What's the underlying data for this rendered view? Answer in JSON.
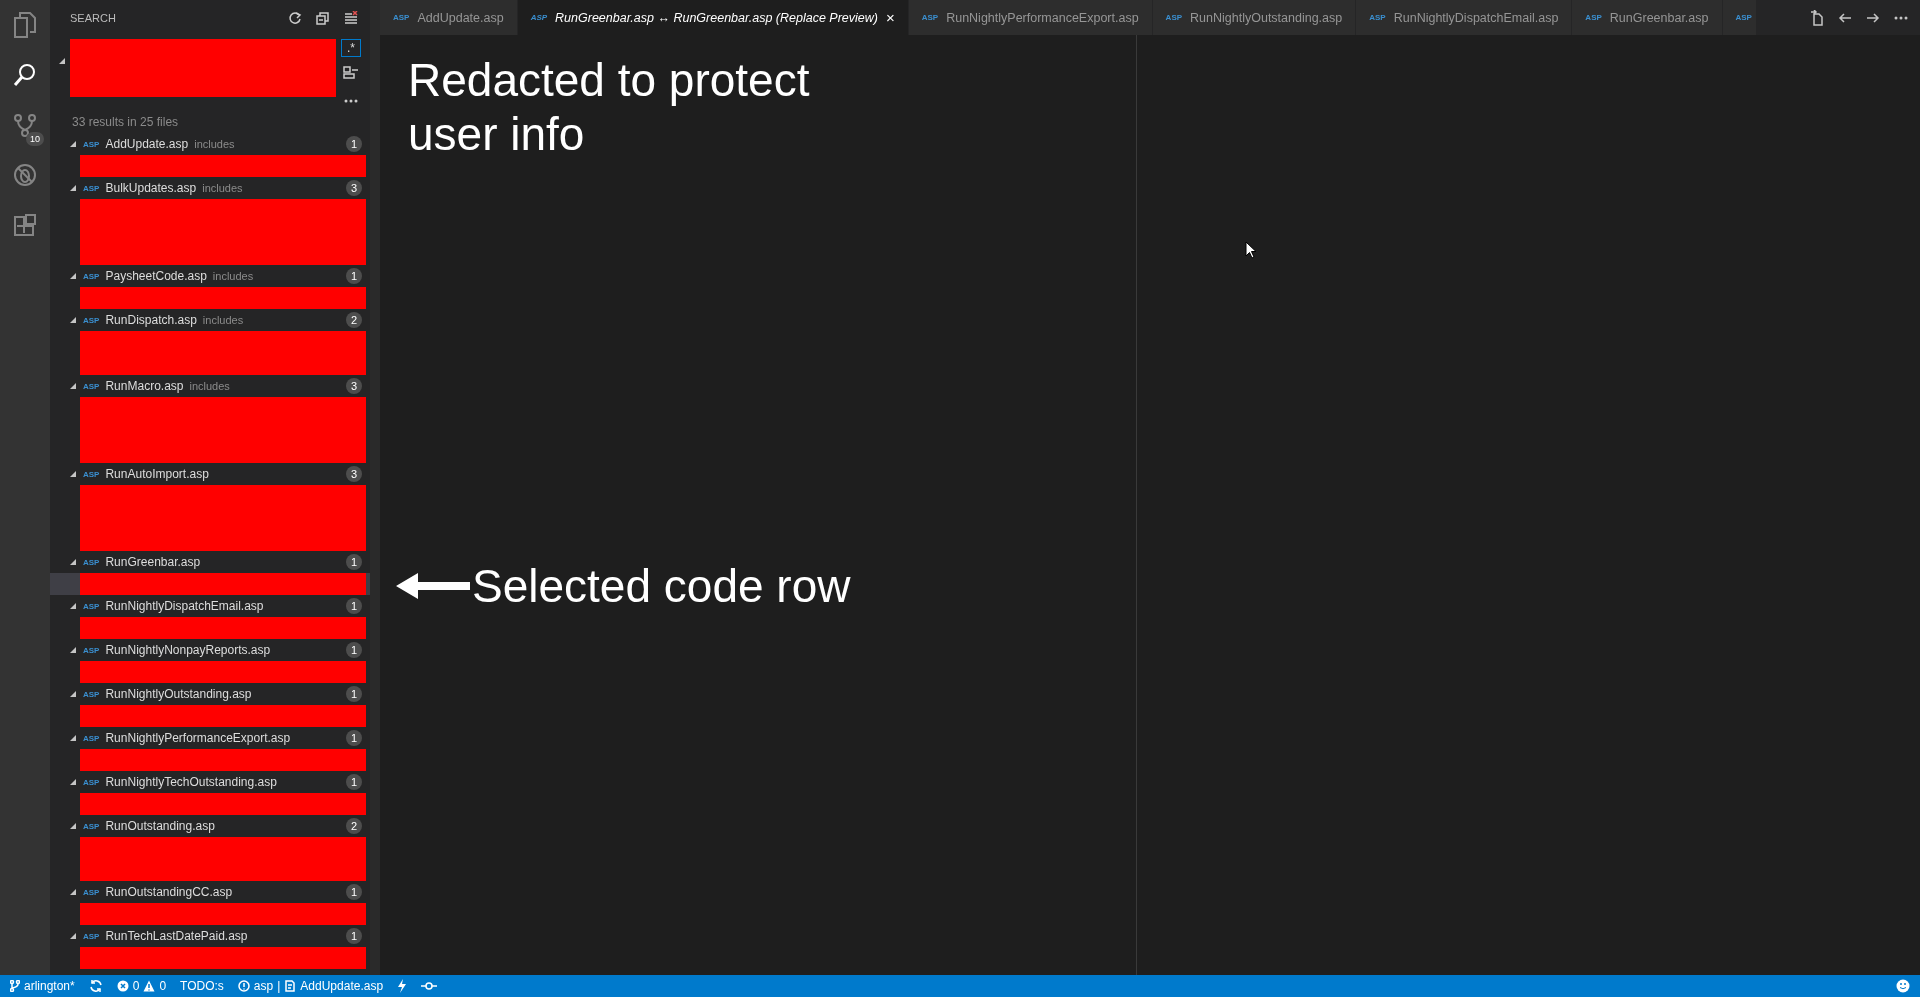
{
  "activity_bar": {
    "items": [
      {
        "kind": "files",
        "selected": false
      },
      {
        "kind": "search",
        "selected": true
      },
      {
        "kind": "source_control",
        "selected": false,
        "badge": "10"
      },
      {
        "kind": "debug",
        "selected": false
      },
      {
        "kind": "extensions",
        "selected": false
      }
    ]
  },
  "sidebar": {
    "title": "SEARCH",
    "search": {
      "kind": "redacted",
      "expanded": true,
      "regex": {
        "label": ".*",
        "on": true
      }
    },
    "summary": "33 results in 25 files",
    "files": [
      {
        "icon_label": "ASP",
        "name": "AddUpdate.asp",
        "detail": "includes",
        "count": "1",
        "expanded": true,
        "results": [
          {
            "kind": "redacted",
            "selected": false
          }
        ]
      },
      {
        "icon_label": "ASP",
        "name": "BulkUpdates.asp",
        "detail": "includes",
        "count": "3",
        "expanded": true,
        "results": [
          {
            "kind": "redacted",
            "selected": false
          },
          {
            "kind": "redacted",
            "selected": false
          },
          {
            "kind": "redacted",
            "selected": false
          }
        ]
      },
      {
        "icon_label": "ASP",
        "name": "PaysheetCode.asp",
        "detail": "includes",
        "count": "1",
        "expanded": true,
        "results": [
          {
            "kind": "redacted",
            "selected": false
          }
        ]
      },
      {
        "icon_label": "ASP",
        "name": "RunDispatch.asp",
        "detail": "includes",
        "count": "2",
        "expanded": true,
        "results": [
          {
            "kind": "redacted",
            "selected": false
          },
          {
            "kind": "redacted",
            "selected": false
          }
        ]
      },
      {
        "icon_label": "ASP",
        "name": "RunMacro.asp",
        "detail": "includes",
        "count": "3",
        "expanded": true,
        "results": [
          {
            "kind": "redacted",
            "selected": false
          },
          {
            "kind": "redacted",
            "selected": false
          },
          {
            "kind": "redacted",
            "selected": false
          }
        ]
      },
      {
        "icon_label": "ASP",
        "name": "RunAutoImport.asp",
        "count": "3",
        "expanded": true,
        "results": [
          {
            "kind": "redacted",
            "selected": false
          },
          {
            "kind": "redacted",
            "selected": false
          },
          {
            "kind": "redacted",
            "selected": false
          }
        ]
      },
      {
        "icon_label": "ASP",
        "name": "RunGreenbar.asp",
        "count": "1",
        "expanded": true,
        "results": [
          {
            "kind": "redacted",
            "selected": true
          }
        ]
      },
      {
        "icon_label": "ASP",
        "name": "RunNightlyDispatchEmail.asp",
        "count": "1",
        "expanded": true,
        "results": [
          {
            "kind": "redacted",
            "selected": false
          }
        ]
      },
      {
        "icon_label": "ASP",
        "name": "RunNightlyNonpayReports.asp",
        "count": "1",
        "expanded": true,
        "results": [
          {
            "kind": "redacted",
            "selected": false
          }
        ]
      },
      {
        "icon_label": "ASP",
        "name": "RunNightlyOutstanding.asp",
        "count": "1",
        "expanded": true,
        "results": [
          {
            "kind": "redacted",
            "selected": false
          }
        ]
      },
      {
        "icon_label": "ASP",
        "name": "RunNightlyPerformanceExport.asp",
        "count": "1",
        "expanded": true,
        "results": [
          {
            "kind": "redacted",
            "selected": false
          }
        ]
      },
      {
        "icon_label": "ASP",
        "name": "RunNightlyTechOutstanding.asp",
        "count": "1",
        "expanded": true,
        "results": [
          {
            "kind": "redacted",
            "selected": false
          }
        ]
      },
      {
        "icon_label": "ASP",
        "name": "RunOutstanding.asp",
        "count": "2",
        "expanded": true,
        "results": [
          {
            "kind": "redacted",
            "selected": false
          },
          {
            "kind": "redacted",
            "selected": false
          }
        ]
      },
      {
        "icon_label": "ASP",
        "name": "RunOutstandingCC.asp",
        "count": "1",
        "expanded": true,
        "results": [
          {
            "kind": "redacted",
            "selected": false
          }
        ]
      },
      {
        "icon_label": "ASP",
        "name": "RunTechLastDatePaid.asp",
        "count": "1",
        "expanded": true,
        "results": [
          {
            "kind": "redacted",
            "selected": false
          }
        ]
      }
    ]
  },
  "tabs": [
    {
      "icon_label": "ASP",
      "label": "AddUpdate.asp",
      "selected": false
    },
    {
      "icon_label": "ASP",
      "label": "RunGreenbar.asp ↔ RunGreenbar.asp (Replace Preview)",
      "selected": true,
      "close": "×"
    },
    {
      "icon_label": "ASP",
      "label": "RunNightlyPerformanceExport.asp",
      "selected": false
    },
    {
      "icon_label": "ASP",
      "label": "RunNightlyOutstanding.asp",
      "selected": false
    },
    {
      "icon_label": "ASP",
      "label": "RunNightlyDispatchEmail.asp",
      "selected": false
    },
    {
      "icon_label": "ASP",
      "label": "RunGreenbar.asp",
      "selected": false
    },
    {
      "icon_label": "ASP",
      "selected": false
    }
  ],
  "annotations": [
    {
      "kind": "note",
      "text": "Redacted to protect user info"
    },
    {
      "kind": "arrow",
      "text": "Selected code row"
    }
  ],
  "status_bar": {
    "branch": "arlington*",
    "errors": "0",
    "warnings": "0",
    "todo": "TODO:s",
    "language": "asp",
    "separator": "|",
    "file": "AddUpdate.asp"
  }
}
